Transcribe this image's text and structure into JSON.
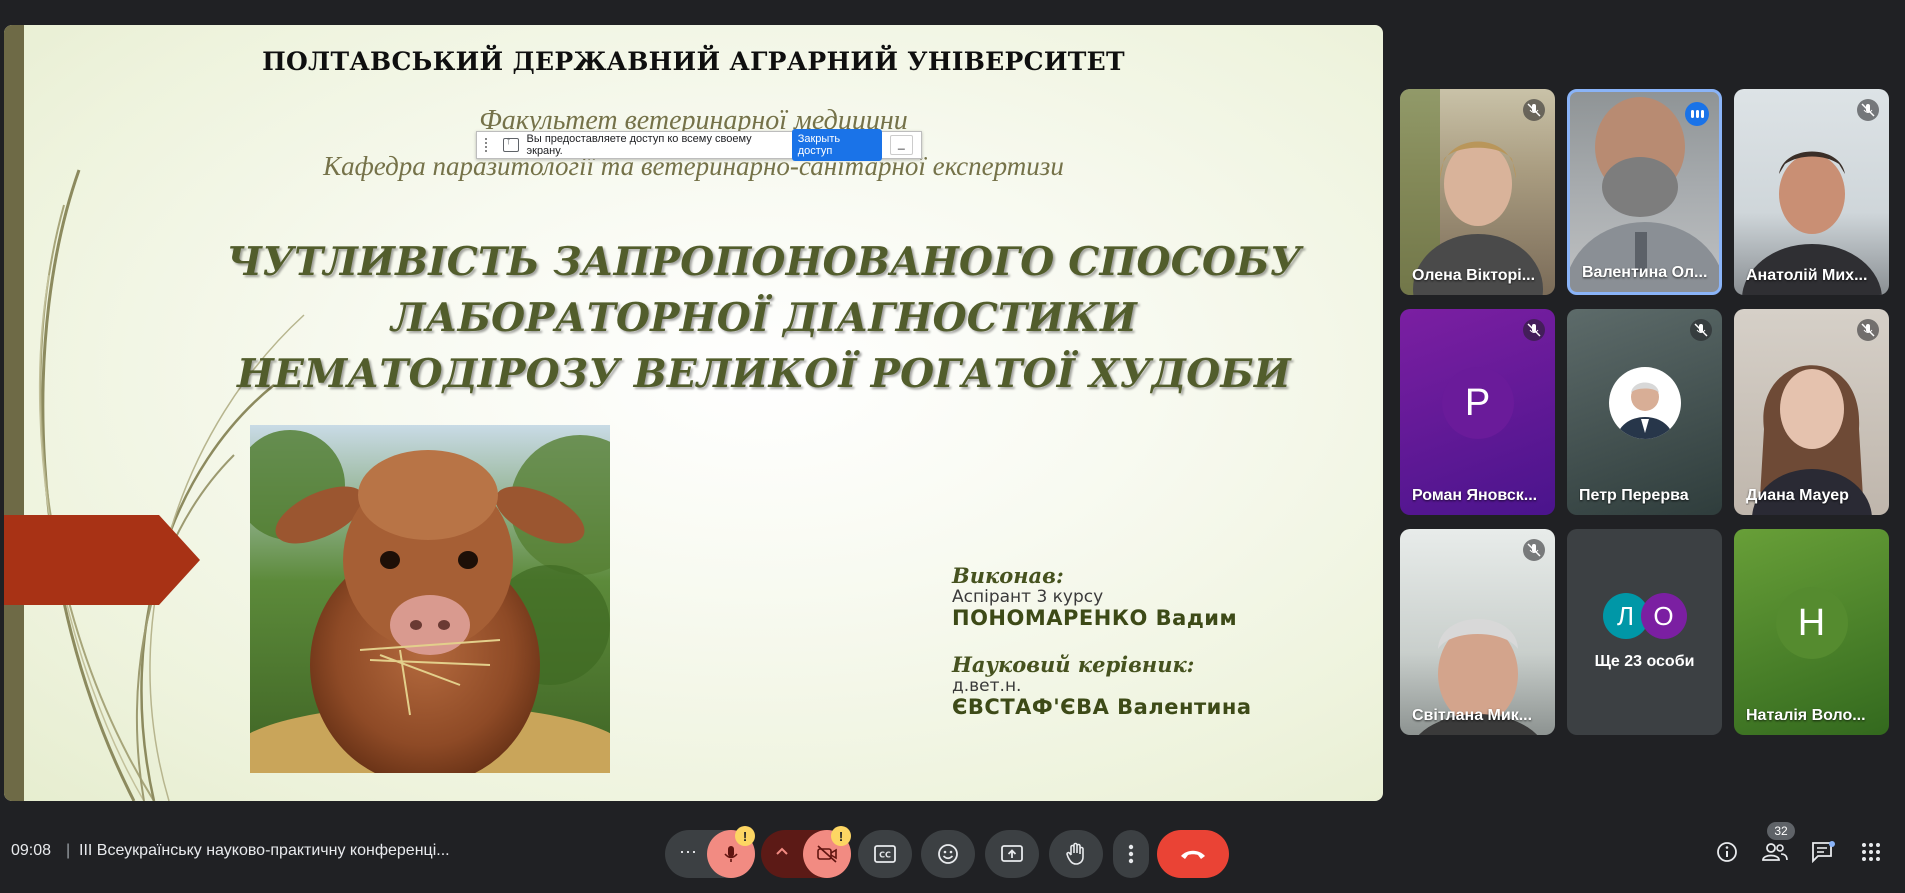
{
  "slide": {
    "university": "ПОЛТАВСЬКИЙ ДЕРЖАВНИЙ АГРАРНИЙ УНІВЕРСИТЕТ",
    "faculty": "Факультет ветеринарної медицини",
    "department": "Кафедра паразитології та ветеринарно-санітарної експертизи",
    "title_lines": [
      "ЧУТЛИВІСТЬ ЗАПРОПОНОВАНОГО СПОСОБУ",
      "ЛАБОРАТОРНОЇ ДІАГНОСТИКИ",
      "НЕМАТОДІРОЗУ ВЕЛИКОЇ РОГАТОЇ ХУДОБИ"
    ],
    "author_role": "Виконав:",
    "author_sub": "Аспірант 3 курсу",
    "author_name": "ПОНОМАРЕНКО Вадим",
    "advisor_role": "Науковий керівник:",
    "advisor_sub": "д.вет.н.",
    "advisor_name": "ЄВСТАФ'ЄВА Валентина"
  },
  "share_bar": {
    "message": "Вы предоставляете доступ ко всему своему экрану.",
    "stop_label": "Закрыть доступ",
    "hide_label": "_"
  },
  "participants": [
    {
      "name": "Олена Вікторі...",
      "muted": true
    },
    {
      "name": "Валентина Ол...",
      "speaking": true
    },
    {
      "name": "Анатолій Мих...",
      "muted": true
    },
    {
      "name": "Роман Яновск...",
      "initial": "Р",
      "avatar_color": "#6a1b9a",
      "muted": true
    },
    {
      "name": "Петр Перерва",
      "muted": true
    },
    {
      "name": "Диана Мауер",
      "muted": true
    },
    {
      "name": "Світлана Мик...",
      "muted": true
    },
    {
      "more_label": "Ще 23 особи",
      "initials": [
        "Л",
        "О"
      ]
    },
    {
      "name": "Наталія Воло...",
      "initial": "Н",
      "avatar_color": "#558b2f"
    }
  ],
  "bottom_bar": {
    "time": "09:08",
    "separator": "|",
    "meeting_title": "ІІІ Всеукраїнську науково-практичну конференці...",
    "mic_badge": "!",
    "cam_badge": "!",
    "people_count": "32",
    "more_dots": "⋯"
  },
  "colors": {
    "background": "#202124",
    "hangup": "#ea4335",
    "muted_red": "#f28b82",
    "accent_blue": "#8ab4f8"
  }
}
